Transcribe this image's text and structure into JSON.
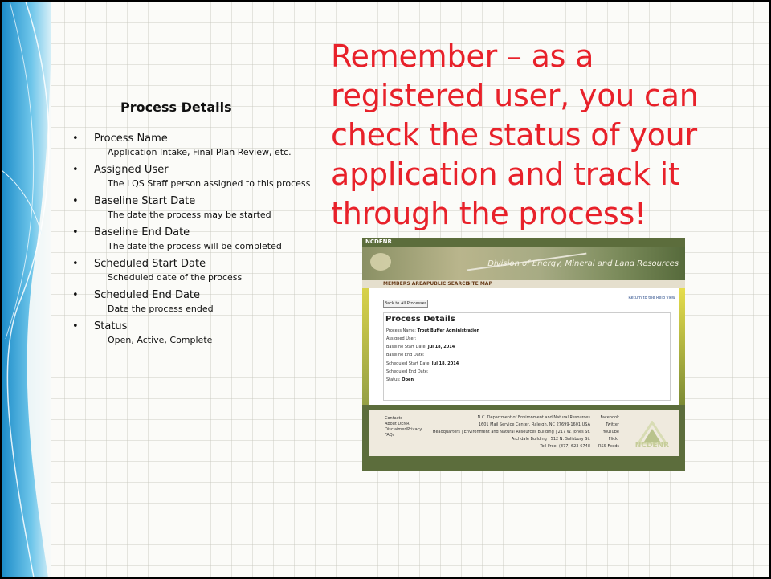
{
  "headline": "Remember – as a registered user, you can check the status of your application and track it through the process!",
  "details_title": "Process Details",
  "items": [
    {
      "name": "Process Name",
      "desc": "Application Intake, Final Plan Review, etc."
    },
    {
      "name": "Assigned User",
      "desc": "The LQS Staff person assigned to this process"
    },
    {
      "name": "Baseline Start Date",
      "desc": "The date the process may be started"
    },
    {
      "name": "Baseline End Date",
      "desc": "The date the process will be completed"
    },
    {
      "name": "Scheduled Start Date",
      "desc": "Scheduled date of the process"
    },
    {
      "name": "Scheduled End Date",
      "desc": "Date the process ended"
    },
    {
      "name": "Status",
      "desc": "Open, Active, Complete"
    }
  ],
  "bullet": "•",
  "screenshot": {
    "org_label": "NCDENR",
    "site_title": "Division of Energy, Mineral and Land Resources",
    "nav": [
      "MEMBERS AREA",
      "PUBLIC SEARCH",
      "SITE MAP"
    ],
    "back_button": "Back to All Processes",
    "return_link": "Return to the Reid view",
    "panel_title": "Process Details",
    "rows": [
      {
        "label": "Process Name:",
        "value": "Trout Buffer Administration"
      },
      {
        "label": "Assigned User:",
        "value": ""
      },
      {
        "label": "Baseline Start Date:",
        "value": "Jul 18, 2014"
      },
      {
        "label": "Baseline End Date:",
        "value": ""
      },
      {
        "label": "Scheduled Start Date:",
        "value": "Jul 18, 2014"
      },
      {
        "label": "Scheduled End Date:",
        "value": ""
      },
      {
        "label": "Status:",
        "value": "Open"
      }
    ],
    "footer_links": [
      "Contacts",
      "About DENR",
      "Disclaimer/Privacy",
      "FAQs"
    ],
    "footer_address": [
      "N.C. Department of Environment and Natural Resources",
      "1601 Mail Service Center, Raleigh, NC 27699-1601 USA",
      "Headquarters | Environment and Natural Resources Building | 217 W. Jones St.",
      "Archdale Building | 512 N. Salisbury St.",
      "Toll Free: (877) 623-6748"
    ],
    "social": [
      "Facebook",
      "Twitter",
      "YouTube",
      "Flickr",
      "RSS Feeds"
    ],
    "logo_text": "NCDENR"
  },
  "colors": {
    "headline": "#e8212a",
    "deco_blue": "#2f9fd6"
  }
}
